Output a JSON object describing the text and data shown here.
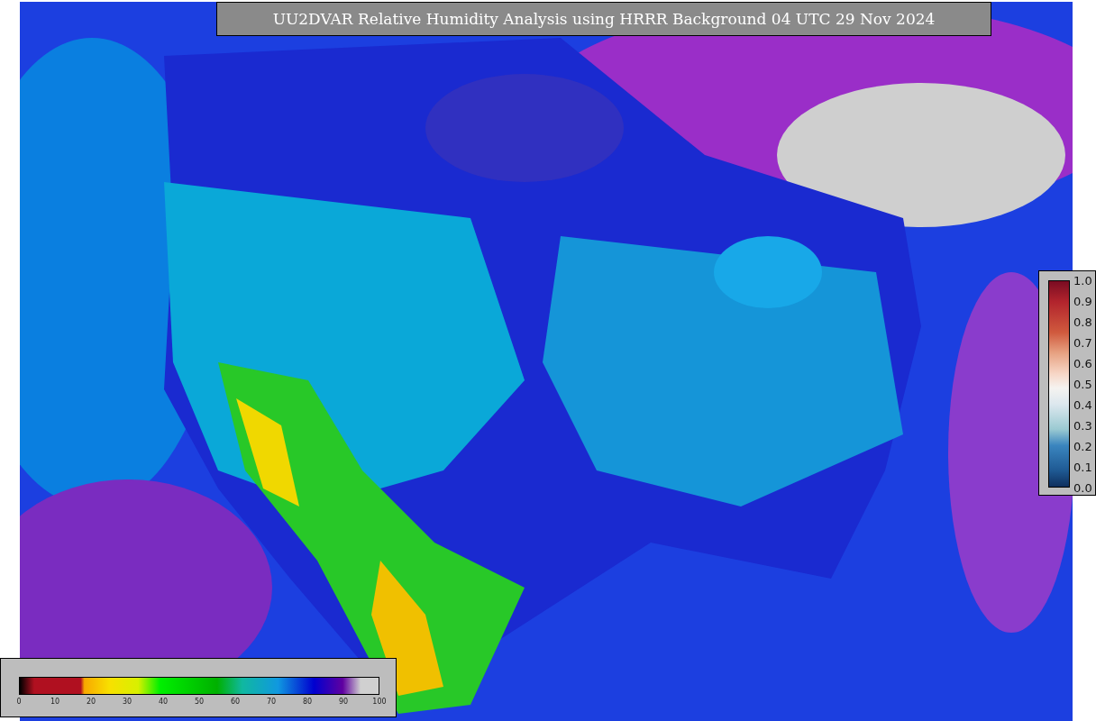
{
  "title": "UU2DVAR Relative Humidity Analysis using HRRR Background 04 UTC 29 Nov 2024",
  "legend_right": {
    "ticks": [
      "1.0",
      "0.9",
      "0.8",
      "0.7",
      "0.6",
      "0.5",
      "0.4",
      "0.3",
      "0.2",
      "0.1",
      "0.0"
    ]
  },
  "legend_bottom": {
    "ticks": [
      "0",
      "10",
      "20",
      "30",
      "40",
      "50",
      "60",
      "70",
      "80",
      "90",
      "100"
    ]
  }
}
